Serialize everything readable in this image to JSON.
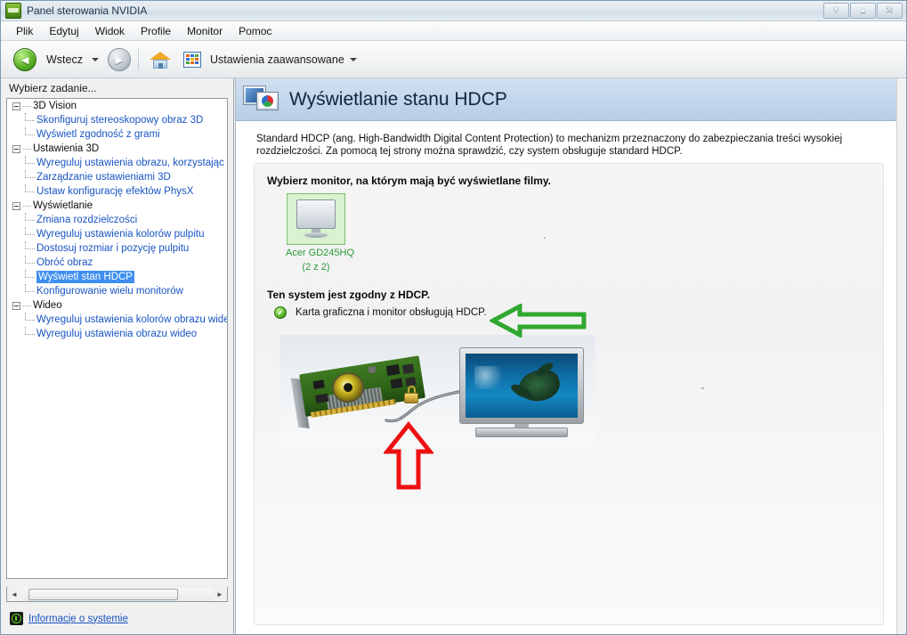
{
  "window": {
    "title": "Panel sterowania NVIDIA",
    "app_icon": "nvidia-icon",
    "caption": {
      "minimize": "▼",
      "maximize": "▲",
      "close": "✕"
    }
  },
  "menubar": {
    "items": [
      {
        "label": "Plik"
      },
      {
        "label": "Edytuj"
      },
      {
        "label": "Widok"
      },
      {
        "label": "Profile"
      },
      {
        "label": "Monitor"
      },
      {
        "label": "Pomoc"
      }
    ]
  },
  "toolbar": {
    "back_label": "Wstecz",
    "back_glyph": "◄",
    "forward_glyph": "►",
    "dropdown_glyph": "▼",
    "home_icon": "home-icon",
    "grid_icon": "grid-view-icon",
    "advanced_label": "Ustawienia zaawansowane"
  },
  "sidebar": {
    "heading": "Wybierz zadanie...",
    "tree": [
      {
        "label": "3D Vision",
        "children": [
          "Skonfiguruj stereoskopowy obraz 3D",
          "Wyświetl zgodność z grami"
        ]
      },
      {
        "label": "Ustawienia 3D",
        "children": [
          "Wyreguluj ustawienia obrazu, korzystając z",
          "Zarządzanie ustawieniami 3D",
          "Ustaw konfigurację efektów PhysX"
        ]
      },
      {
        "label": "Wyświetlanie",
        "children": [
          "Zmiana rozdzielczości",
          "Wyreguluj ustawienia kolorów pulpitu",
          "Dostosuj rozmiar i pozycję pulpitu",
          "Obróć obraz",
          "Wyświetl stan HDCP",
          "Konfigurowanie wielu monitorów"
        ]
      },
      {
        "label": "Wideo",
        "children": [
          "Wyreguluj ustawienia kolorów obrazu wideo",
          "Wyreguluj ustawienia obrazu wideo"
        ]
      }
    ],
    "selected_item": "Wyświetl stan HDCP",
    "scrollbar": {
      "left_glyph": "◄",
      "right_glyph": "►"
    },
    "system_info_label": "Informacje o systemie",
    "system_info_icon": "info-icon"
  },
  "page": {
    "header_icon": "hdcp-display-icon",
    "title": "Wyświetlanie stanu HDCP",
    "description": "Standard HDCP (ang. High-Bandwidth Digital Content Protection) to mechanizm przeznaczony do zabezpieczania treści wysokiej rozdzielczości. Za pomocą tej strony można sprawdzić, czy system obsługuje standard HDCP.",
    "monitor_section": {
      "heading": "Wybierz monitor, na którym mają być wyświetlane filmy.",
      "monitor": {
        "name": "Acer GD245HQ",
        "index": "(2 z 2)",
        "selected": true
      }
    },
    "hdcp_section": {
      "heading": "Ten system jest zgodny z HDCP.",
      "status_icon": "check-circle-icon",
      "status_text": "Karta graficzna i monitor obsługują HDCP.",
      "illustration_alt": "Karta graficzna połączona kablem z kłódką i telewizorem"
    }
  },
  "annotations": {
    "green_arrow": {
      "name": "green-arrow-annotation",
      "direction": "left",
      "color": "#2fa82f"
    },
    "red_arrow": {
      "name": "red-arrow-annotation",
      "direction": "up",
      "color": "#ee1111"
    }
  },
  "colors": {
    "accent_link": "#1854c4",
    "selection": "#3e8ff0",
    "header_gradient_top": "#d2e0f0",
    "header_gradient_bottom": "#b7cfe7",
    "monitor_select_green": "#2a9a35",
    "status_green": "#59b22a"
  }
}
